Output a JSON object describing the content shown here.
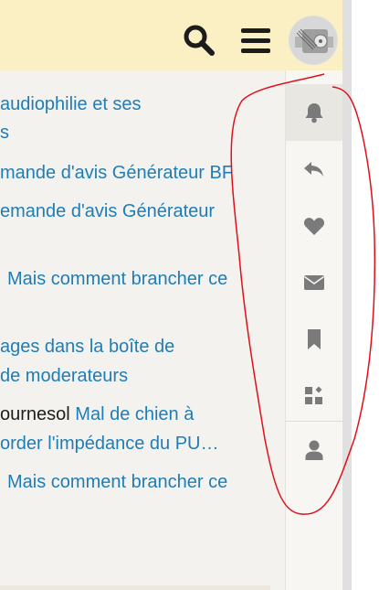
{
  "header": {
    "search_icon": "search-icon",
    "menu_icon": "hamburger-menu-icon",
    "avatar_icon": "user-avatar"
  },
  "threads": [
    {
      "user": "",
      "title": "audiophilie et ses"
    },
    {
      "user": "",
      "title": "s"
    },
    {
      "user": "",
      "title": "mande d'avis Générateur BF"
    },
    {
      "user": "",
      "title": "emande d'avis Générateur"
    },
    {
      "user": "",
      "title": "Mais comment brancher ce"
    },
    {
      "user": "",
      "title": "ages dans la boîte de"
    },
    {
      "user": "",
      "title": "de moderateurs"
    },
    {
      "user": "ournesol",
      "title": "Mal de chien à"
    },
    {
      "user": "",
      "title": "order l'impédance du PU…"
    },
    {
      "user": "",
      "title": "Mais comment brancher ce"
    }
  ],
  "sidebar": {
    "items": [
      {
        "icon": "bell-icon",
        "label": "alerts"
      },
      {
        "icon": "reply-icon",
        "label": "replies"
      },
      {
        "icon": "heart-icon",
        "label": "likes"
      },
      {
        "icon": "envelope-icon",
        "label": "messages"
      },
      {
        "icon": "bookmark-icon",
        "label": "bookmarks"
      },
      {
        "icon": "widgets-icon",
        "label": "widgets"
      },
      {
        "icon": "user-icon",
        "label": "profile"
      }
    ]
  },
  "colors": {
    "header_bg": "#fbf0c4",
    "link": "#1f7db5",
    "icon_gray": "#7a7a7a",
    "annotation_red": "#e0101a"
  }
}
